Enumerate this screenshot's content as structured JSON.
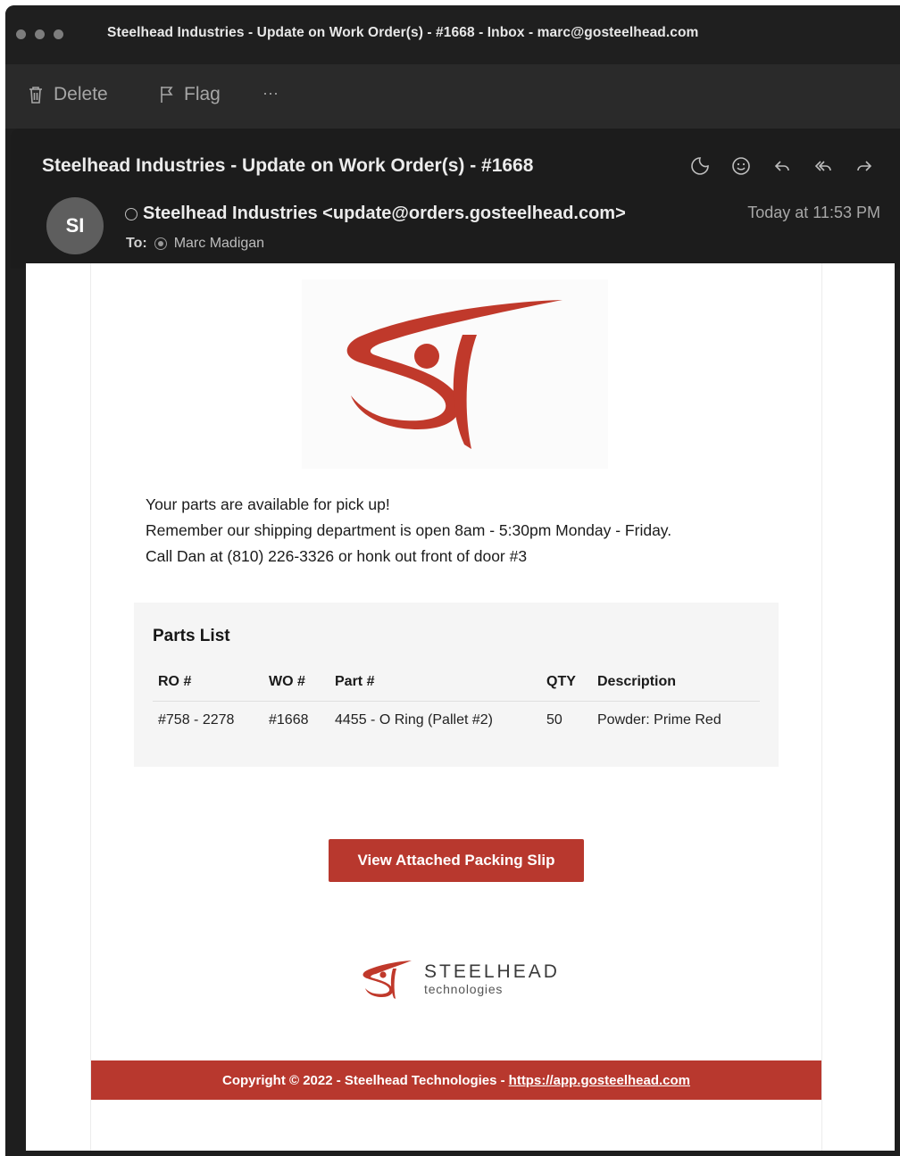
{
  "window": {
    "title": "Steelhead Industries - Update on Work Order(s) - #1668 - Inbox - marc@gosteelhead.com"
  },
  "toolbar": {
    "delete_label": "Delete",
    "flag_label": "Flag",
    "more_label": "···"
  },
  "email": {
    "subject": "Steelhead Industries - Update on Work Order(s) - #1668",
    "avatar_initials": "SI",
    "from": "Steelhead Industries <update@orders.gosteelhead.com>",
    "date": "Today at 11:53 PM",
    "to_label": "To:",
    "to": "Marc Madigan"
  },
  "body": {
    "message_lines": [
      "Your parts are available for pick up!",
      "Remember our shipping department is open 8am - 5:30pm Monday - Friday.",
      "Call Dan at (810) 226-3326 or honk out front of door #3"
    ],
    "parts_list": {
      "title": "Parts List",
      "columns": [
        "RO #",
        "WO #",
        "Part #",
        "QTY",
        "Description"
      ],
      "rows": [
        [
          "#758 - 2278",
          "#1668",
          "4455 - O Ring (Pallet #2)",
          "50",
          "Powder: Prime Red"
        ]
      ]
    },
    "cta_label": "View Attached Packing Slip",
    "brand": {
      "name": "STEELHEAD",
      "tagline": "technologies"
    },
    "footer": {
      "copyright": "Copyright © 2022 - Steelhead Technologies - ",
      "link": "https://app.gosteelhead.com"
    }
  },
  "colors": {
    "brand_red": "#b8382e",
    "header_bg": "#1c1c1c",
    "toolbar_bg": "#2a2a2a"
  }
}
